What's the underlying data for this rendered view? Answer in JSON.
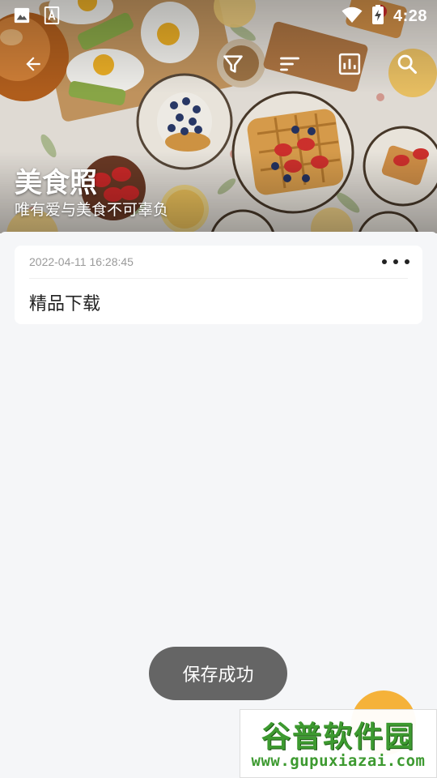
{
  "status_bar": {
    "time": "4:28",
    "left_icons": [
      "image-icon",
      "a-box-icon"
    ],
    "right_icons": [
      "wifi-icon",
      "battery-charging-icon"
    ]
  },
  "toolbar": {
    "back_icon": "arrow-left-icon",
    "actions": [
      "filter-icon",
      "sort-icon",
      "bar-chart-icon",
      "search-icon"
    ]
  },
  "header": {
    "title": "美食照",
    "subtitle": "唯有爱与美食不可辜负"
  },
  "record": {
    "date": "2022-04-11 16:28:45",
    "text": "精品下载",
    "more_icon": "more-horizontal-icon"
  },
  "toast": {
    "message": "保存成功"
  },
  "watermark": {
    "title": "谷普软件园",
    "url": "www.gupuxiazai.com"
  },
  "colors": {
    "background": "#f5f6f8",
    "card": "#ffffff",
    "fab": "#f5b23a",
    "toast": "#585858",
    "watermark_green": "#3d9a30"
  }
}
